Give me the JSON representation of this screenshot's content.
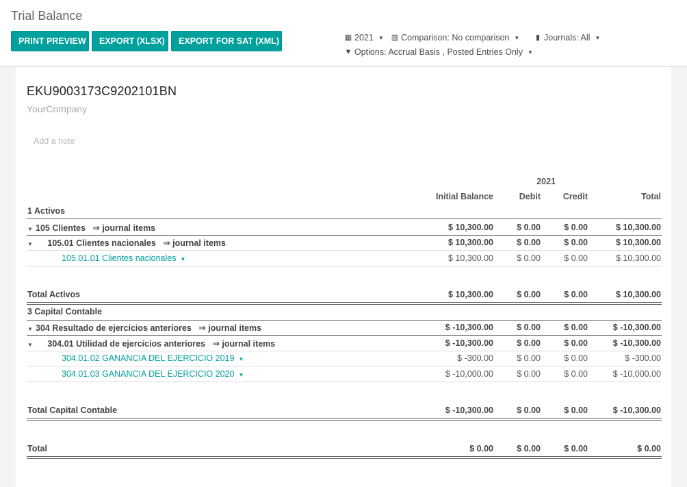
{
  "header": {
    "title": "Trial Balance",
    "buttons": [
      "PRINT PREVIEW",
      "EXPORT (XLSX)",
      "EXPORT FOR SAT (XML)"
    ],
    "filters": {
      "year": "2021",
      "comparison": "Comparison: No comparison",
      "journals": "Journals: All",
      "options": "Options: Accrual Basis , Posted Entries Only"
    }
  },
  "report": {
    "vat": "EKU9003173C9202101BN",
    "company": "YourCompany",
    "note_placeholder": "Add a note",
    "period": "2021",
    "columns": [
      "Initial Balance",
      "Debit",
      "Credit",
      "Total"
    ],
    "sections": [
      {
        "name": "1 Activos"
      },
      {
        "name": "3 Capital Contable"
      }
    ],
    "rows": [
      {
        "label": "105 Clientes",
        "suffix": "⇒ journal items",
        "values": [
          "$ 10,300.00",
          "$ 0.00",
          "$ 0.00",
          "$ 10,300.00"
        ]
      },
      {
        "label": "105.01 Clientes nacionales",
        "suffix": "⇒ journal items",
        "values": [
          "$ 10,300.00",
          "$ 0.00",
          "$ 0.00",
          "$ 10,300.00"
        ]
      },
      {
        "label": "105.01.01 Clientes nacionales",
        "values": [
          "$ 10,300.00",
          "$ 0.00",
          "$ 0.00",
          "$ 10,300.00"
        ]
      },
      {
        "label": "Total Activos",
        "values": [
          "$ 10,300.00",
          "$ 0.00",
          "$ 0.00",
          "$ 10,300.00"
        ]
      },
      {
        "label": "304 Resultado de ejercicios anteriores",
        "suffix": "⇒ journal items",
        "values": [
          "$ -10,300.00",
          "$ 0.00",
          "$ 0.00",
          "$ -10,300.00"
        ]
      },
      {
        "label": "304.01 Utilidad de ejercicios anteriores",
        "suffix": "⇒ journal items",
        "values": [
          "$ -10,300.00",
          "$ 0.00",
          "$ 0.00",
          "$ -10,300.00"
        ]
      },
      {
        "label": "304.01.02 GANANCIA DEL EJERCICIO 2019",
        "values": [
          "$ -300.00",
          "$ 0.00",
          "$ 0.00",
          "$ -300.00"
        ]
      },
      {
        "label": "304.01.03 GANANCIA DEL EJERCICIO 2020",
        "values": [
          "$ -10,000.00",
          "$ 0.00",
          "$ 0.00",
          "$ -10,000.00"
        ]
      },
      {
        "label": "Total Capital Contable",
        "values": [
          "$ -10,300.00",
          "$ 0.00",
          "$ 0.00",
          "$ -10,300.00"
        ]
      },
      {
        "label": "Total",
        "values": [
          "$ 0.00",
          "$ 0.00",
          "$ 0.00",
          "$ 0.00"
        ]
      }
    ]
  }
}
